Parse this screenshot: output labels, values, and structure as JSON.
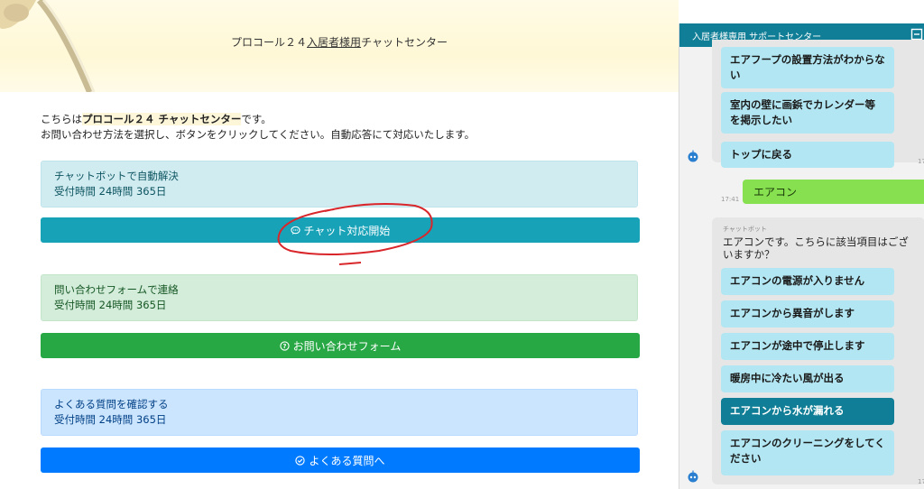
{
  "banner": {
    "title_prefix": "プロコール２４",
    "title_underlined": "入居者様用",
    "title_suffix": "チャットセンター"
  },
  "intro": {
    "line1_prefix": "こちらは",
    "line1_bold": "プロコール２４ チャットセンター",
    "line1_suffix": "です。",
    "line2": "お問い合わせ方法を選択し、ボタンをクリックしてください。自動応答にて対応いたします。"
  },
  "sections": [
    {
      "title": "チャットボットで自動解決",
      "hours": "受付時間 24時間 365日",
      "button": "チャット対応開始",
      "icon": "chat-bubble-icon"
    },
    {
      "title": "問い合わせフォームで連絡",
      "hours": "受付時間 24時間 365日",
      "button": "お問い合わせフォーム",
      "icon": "question-circle-icon"
    },
    {
      "title": "よくある質問を確認する",
      "hours": "受付時間 24時間 365日",
      "button": "よくある質問へ",
      "icon": "check-circle-icon"
    }
  ],
  "chat": {
    "header": "入居者様専用 サポートセンター",
    "options_prev": [
      "エアフープの設置方法がわからない",
      "室内の壁に画鋲でカレンダー等を掲示したい",
      "トップに戻る"
    ],
    "user_message": "エアコン",
    "user_time": "17:41",
    "bot_label": "チャットボット",
    "bot_text": "エアコンです。こちらに該当項目はございますか？",
    "options": [
      "エアコンの電源が入りません",
      "エアコンから異音がします",
      "エアコンが途中で停止します",
      "暖房中に冷たい風が出る",
      "エアコンから水が漏れる",
      "エアコンのクリーニングをしてください"
    ],
    "selected_index": 4,
    "time_partial_1": "17",
    "time_partial_2": "17"
  },
  "colors": {
    "teal_button": "#17a2b8",
    "green_button": "#28a745",
    "blue_button": "#007bff",
    "chat_header": "#0f7e96",
    "option_bg": "#b2e6f2",
    "user_bubble": "#86e04f"
  }
}
